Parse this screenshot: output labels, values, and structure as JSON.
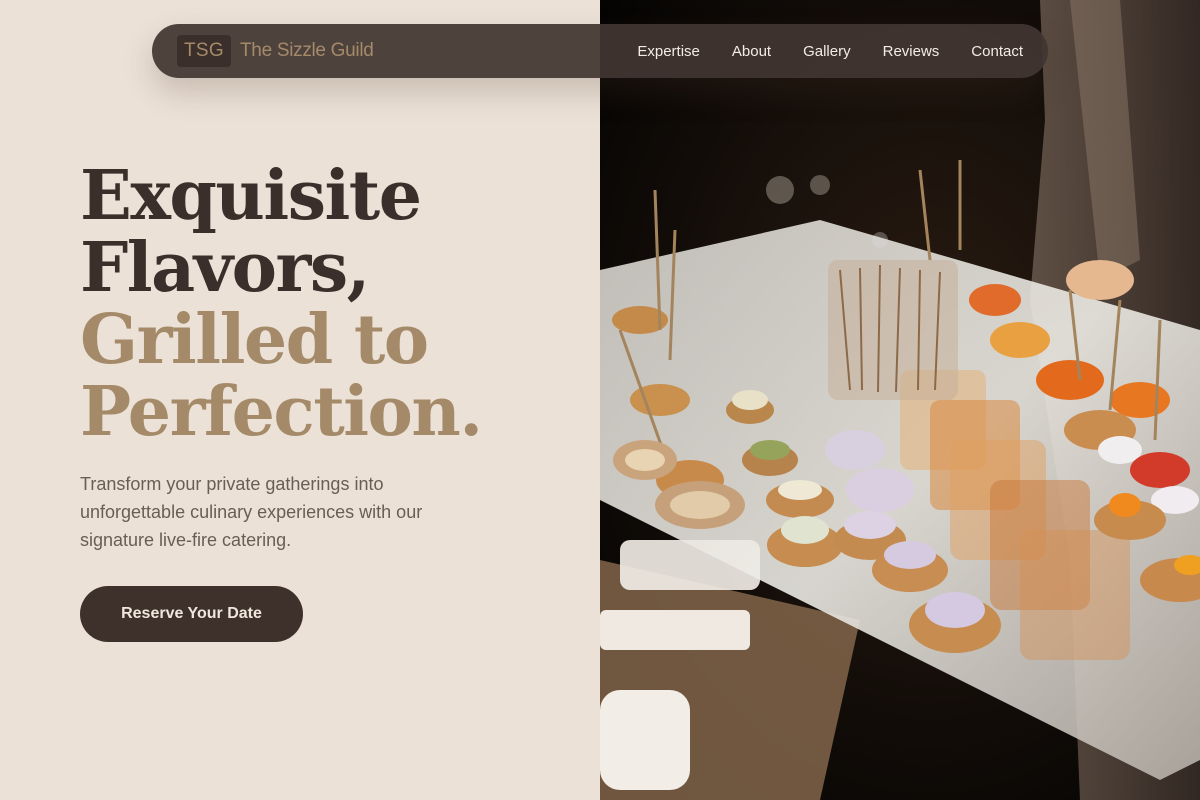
{
  "nav": {
    "logo_mark": "TSG",
    "brand_name": "The Sizzle Guild",
    "links": [
      "Expertise",
      "About",
      "Gallery",
      "Reviews",
      "Contact"
    ]
  },
  "hero": {
    "title_line1": "Exquisite",
    "title_line2": "Flavors,",
    "title_line3": "Grilled to",
    "title_line4": "Perfection.",
    "subtitle": "Transform your private gatherings into unforgettable culinary experiences with our signature live-fire catering.",
    "cta_label": "Reserve Your Date"
  },
  "colors": {
    "background": "#ebe1d7",
    "nav_bg": "#423632",
    "brand_accent": "#a58a6a",
    "title_dark": "#3a2f2a",
    "title_accent": "#a48a68",
    "cta_bg": "#3e312c"
  }
}
